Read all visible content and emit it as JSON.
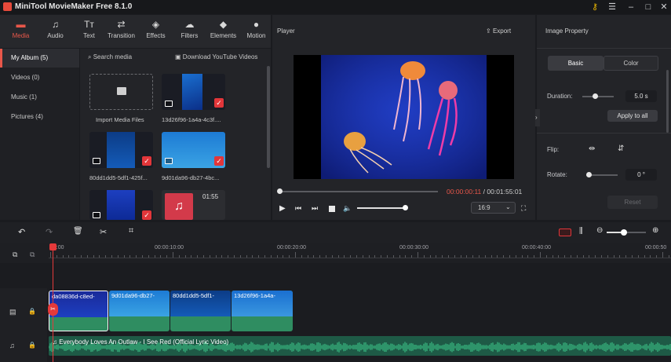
{
  "app": {
    "title": "MiniTool MovieMaker Free 8.1.0"
  },
  "nav": [
    {
      "label": "Media",
      "icon": "folder-icon"
    },
    {
      "label": "Audio",
      "icon": "music-note-icon"
    },
    {
      "label": "Text",
      "icon": "text-icon"
    },
    {
      "label": "Transition",
      "icon": "transition-icon"
    },
    {
      "label": "Effects",
      "icon": "effects-icon"
    },
    {
      "label": "Filters",
      "icon": "filters-icon"
    },
    {
      "label": "Elements",
      "icon": "elements-icon"
    },
    {
      "label": "Motion",
      "icon": "motion-icon"
    }
  ],
  "sidebar": [
    {
      "label": "My Album (5)"
    },
    {
      "label": "Videos (0)"
    },
    {
      "label": "Music (1)"
    },
    {
      "label": "Pictures (4)"
    }
  ],
  "media": {
    "search": "Search media",
    "download": "Download YouTube Videos",
    "import_label": "Import Media Files",
    "items": [
      {
        "name": "13d26f96-1a4a-4c3f...."
      },
      {
        "name": "80dd1dd5-5df1-425f..."
      },
      {
        "name": "9d01da96-db27-4bc..."
      },
      {
        "name": ""
      },
      {
        "name": "",
        "duration": "01:55"
      }
    ]
  },
  "player": {
    "title": "Player",
    "export": "Export",
    "current": "00:00:00:11",
    "separator": " / ",
    "total": "00:01:55:01",
    "aspect": "16:9",
    "progress": 0.005,
    "volume": 0.95
  },
  "property": {
    "title": "Image Property",
    "tab_basic": "Basic",
    "tab_color": "Color",
    "duration_label": "Duration:",
    "duration_value": "5.0 s",
    "apply_all": "Apply to all",
    "flip_label": "Flip:",
    "rotate_label": "Rotate:",
    "rotate_value": "0 °",
    "reset": "Reset"
  },
  "ruler": [
    "00:00",
    "00:00:10:00",
    "00:00:20:00",
    "00:00:30:00",
    "00:00:40:00",
    "00:00:50"
  ],
  "clips": [
    {
      "name": "da08836d-c8ed-"
    },
    {
      "name": "9d01da96-db27-"
    },
    {
      "name": "80dd1dd5-5df1-"
    },
    {
      "name": "13d26f96-1a4a-"
    }
  ],
  "audio_track": {
    "name": "Everybody Loves An Outlaw - I See Red (Official Lyric Video)"
  },
  "colors": {
    "accent": "#e8574a",
    "clip_green": "#2f8d61",
    "playhead": "#e5393a"
  }
}
